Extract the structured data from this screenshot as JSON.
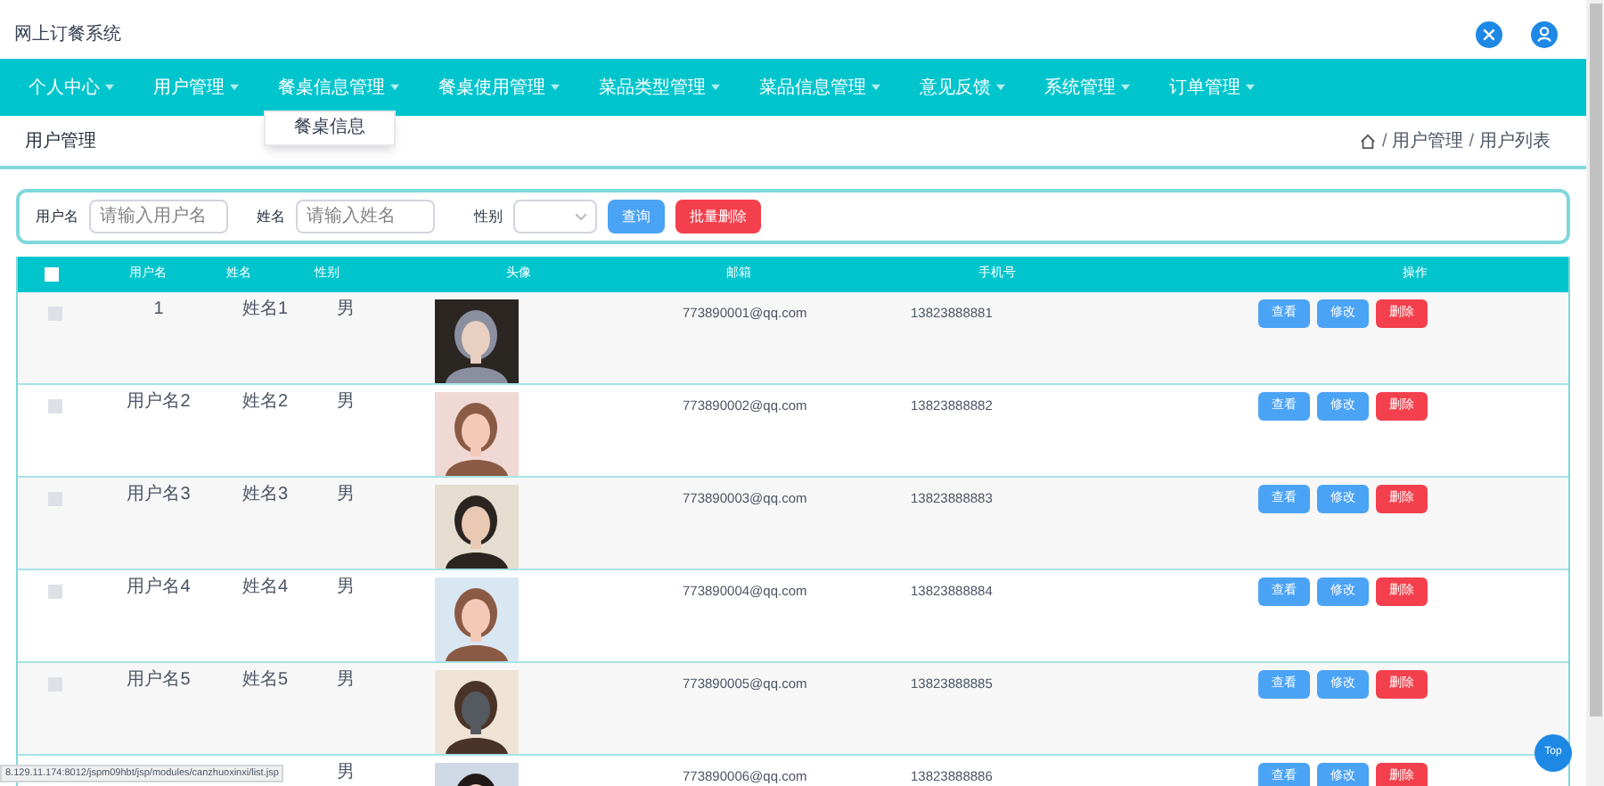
{
  "header": {
    "title": "网上订餐系统"
  },
  "nav": [
    {
      "label": "个人中心"
    },
    {
      "label": "用户管理"
    },
    {
      "label": "餐桌信息管理",
      "menu": [
        "餐桌信息"
      ]
    },
    {
      "label": "餐桌使用管理"
    },
    {
      "label": "菜品类型管理"
    },
    {
      "label": "菜品信息管理"
    },
    {
      "label": "意见反馈"
    },
    {
      "label": "系统管理"
    },
    {
      "label": "订单管理"
    }
  ],
  "page_title": "用户管理",
  "breadcrumb": [
    {
      "separator": "/",
      "label": "用户管理"
    },
    {
      "separator": "/",
      "label": "用户列表"
    }
  ],
  "search": {
    "fields": [
      {
        "label": "用户名",
        "placeholder": "请输入用户名"
      },
      {
        "label": "姓名",
        "placeholder": "请输入姓名"
      }
    ],
    "select_label": "性别",
    "buttons": [
      {
        "label": "查询",
        "kind": "primary"
      },
      {
        "label": "批量删除",
        "kind": "danger"
      }
    ]
  },
  "table": {
    "select_all_checked": false,
    "columns": [
      "用户名",
      "姓名",
      "性别",
      "头像",
      "邮箱",
      "手机号",
      "操作"
    ],
    "rows": [
      {
        "username": "1",
        "name": "姓名1",
        "gender": "男",
        "email": "773890001@qq.com",
        "phone": "13823888881",
        "checked": false,
        "actions": [
          {
            "label": "查看",
            "kind": "view"
          },
          {
            "label": "修改",
            "kind": "edit"
          },
          {
            "label": "删除",
            "kind": "delete"
          }
        ]
      },
      {
        "username": "用户名2",
        "name": "姓名2",
        "gender": "男",
        "email": "773890002@qq.com",
        "phone": "13823888882",
        "checked": false,
        "actions": [
          {
            "label": "查看",
            "kind": "view"
          },
          {
            "label": "修改",
            "kind": "edit"
          },
          {
            "label": "删除",
            "kind": "delete"
          }
        ]
      },
      {
        "username": "用户名3",
        "name": "姓名3",
        "gender": "男",
        "email": "773890003@qq.com",
        "phone": "13823888883",
        "checked": false,
        "actions": [
          {
            "label": "查看",
            "kind": "view"
          },
          {
            "label": "修改",
            "kind": "edit"
          },
          {
            "label": "删除",
            "kind": "delete"
          }
        ]
      },
      {
        "username": "用户名4",
        "name": "姓名4",
        "gender": "男",
        "email": "773890004@qq.com",
        "phone": "13823888884",
        "checked": false,
        "actions": [
          {
            "label": "查看",
            "kind": "view"
          },
          {
            "label": "修改",
            "kind": "edit"
          },
          {
            "label": "删除",
            "kind": "delete"
          }
        ]
      },
      {
        "username": "用户名5",
        "name": "姓名5",
        "gender": "男",
        "email": "773890005@qq.com",
        "phone": "13823888885",
        "checked": false,
        "actions": [
          {
            "label": "查看",
            "kind": "view"
          },
          {
            "label": "修改",
            "kind": "edit"
          },
          {
            "label": "删除",
            "kind": "delete"
          }
        ]
      },
      {
        "gender": "男",
        "email": "773890006@qq.com",
        "phone": "13823888886",
        "actions": [
          {
            "label": "查看",
            "kind": "view"
          },
          {
            "label": "修改",
            "kind": "edit"
          },
          {
            "label": "删除",
            "kind": "delete"
          }
        ]
      }
    ]
  },
  "status_url": "8.129.11.174:8012/jspm09hbt/jsp/modules/canzhuoxinxi/list.jsp",
  "top_button": "Top"
}
